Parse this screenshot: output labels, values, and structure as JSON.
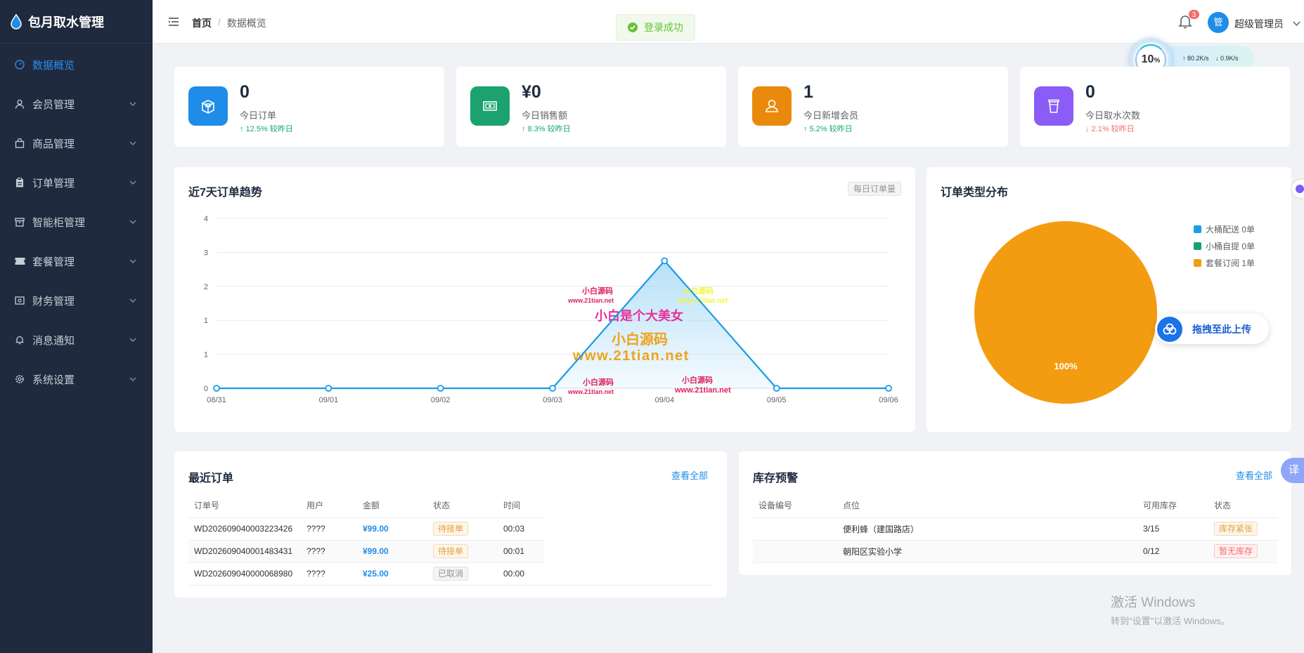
{
  "app": {
    "title": "包月取水管理"
  },
  "sidebar": {
    "items": [
      {
        "label": "数据概览",
        "icon": "dashboard-icon",
        "active": true
      },
      {
        "label": "会员管理",
        "icon": "user-icon"
      },
      {
        "label": "商品管理",
        "icon": "bag-icon"
      },
      {
        "label": "订单管理",
        "icon": "clipboard-icon"
      },
      {
        "label": "智能柜管理",
        "icon": "cabinet-icon"
      },
      {
        "label": "套餐管理",
        "icon": "ticket-icon"
      },
      {
        "label": "财务管理",
        "icon": "wallet-icon"
      },
      {
        "label": "消息通知",
        "icon": "bell-icon"
      },
      {
        "label": "系统设置",
        "icon": "gear-icon"
      }
    ]
  },
  "header": {
    "breadcrumb": {
      "home": "首页",
      "separator": "/",
      "current": "数据概览"
    },
    "toast": "登录成功",
    "notification_count": "3",
    "avatar_text": "管",
    "username": "超级管理员"
  },
  "netspeed": {
    "percent": "10",
    "unit": "%",
    "upload": "↑ 80.2K/s",
    "download": "↓ 0.9K/s"
  },
  "stats": [
    {
      "value": "0",
      "label": "今日订单",
      "trend": "↑ 12.5% 较昨日",
      "direction": "up",
      "color": "#1f8ce8"
    },
    {
      "value": "¥0",
      "label": "今日销售额",
      "trend": "↑ 8.3% 较昨日",
      "direction": "up",
      "color": "#1aa36f"
    },
    {
      "value": "1",
      "label": "今日新增会员",
      "trend": "↑ 5.2% 较昨日",
      "direction": "up",
      "color": "#ea8a0c"
    },
    {
      "value": "0",
      "label": "今日取水次数",
      "trend": "↓ 2.1% 较昨日",
      "direction": "down",
      "color": "#8b5cf6"
    }
  ],
  "trend_chart": {
    "title": "近7天订单趋势",
    "tag": "每日订单量"
  },
  "chart_data": [
    {
      "type": "area",
      "title": "近7天订单趋势",
      "x": [
        "08/31",
        "09/01",
        "09/02",
        "09/03",
        "09/04",
        "09/05",
        "09/06"
      ],
      "values": [
        0,
        0,
        0,
        0,
        3,
        0,
        0
      ],
      "y_ticks": [
        "0",
        "1",
        "1",
        "2",
        "3",
        "4"
      ],
      "ylim": [
        0,
        4
      ],
      "grid": true,
      "line_color": "#1a9be6"
    },
    {
      "type": "pie",
      "title": "订单类型分布",
      "categories": [
        "大桶配送",
        "小桶自提",
        "套餐订阅"
      ],
      "values": [
        0,
        0,
        1
      ],
      "legend": [
        "大桶配送 0单",
        "小桶自提 0单",
        "套餐订阅 1单"
      ],
      "colors": [
        "#1f9be6",
        "#13a36b",
        "#f39c12"
      ],
      "slice_label": "100%",
      "legend_position": "top-right"
    }
  ],
  "pie_chart": {
    "title": "订单类型分布",
    "legend": [
      "大桶配送 0单",
      "小桶自提 0单",
      "套餐订阅 1单"
    ],
    "colors": [
      "#1f9be6",
      "#13a36b",
      "#f39c12"
    ],
    "slice_label": "100%"
  },
  "watermark": {
    "a": "小白源码",
    "a_url": "www.21tian.net",
    "b": "小白源码",
    "b_url": "www.21tian.net",
    "main": "小白是个大美女",
    "brand": "小白源码",
    "brand_url": "www.21tian.net",
    "c": "小白源码",
    "c_url": "www.21tian.net",
    "d": "小白源码",
    "d_url": "www.21tian.net"
  },
  "upload_button": "拖拽至此上传",
  "recent_orders": {
    "title": "最近订单",
    "view_all": "查看全部",
    "columns": [
      "订单号",
      "用户",
      "金额",
      "状态",
      "时间"
    ],
    "rows": [
      {
        "id": "WD202609040003223426",
        "user": "????",
        "amount": "¥99.00",
        "status": "待接单",
        "time": "00:03"
      },
      {
        "id": "WD202609040001483431",
        "user": "????",
        "amount": "¥99.00",
        "status": "待接单",
        "time": "00:01"
      },
      {
        "id": "WD202609040000068980",
        "user": "????",
        "amount": "¥25.00",
        "status": "已取消",
        "time": "00:00"
      }
    ]
  },
  "stock_alert": {
    "title": "库存预警",
    "view_all": "查看全部",
    "columns": [
      "设备编号",
      "点位",
      "可用库存",
      "状态"
    ],
    "rows": [
      {
        "device": "",
        "location": "便利蜂（建国路店）",
        "stock": "3/15",
        "status": "库存紧张"
      },
      {
        "device": "",
        "location": "朝阳区实验小学",
        "stock": "0/12",
        "status": "暂无库存"
      }
    ]
  },
  "windows_activation": {
    "line1": "激活 Windows",
    "line2": "转到\"设置\"以激活 Windows。"
  },
  "translate_button": "译"
}
